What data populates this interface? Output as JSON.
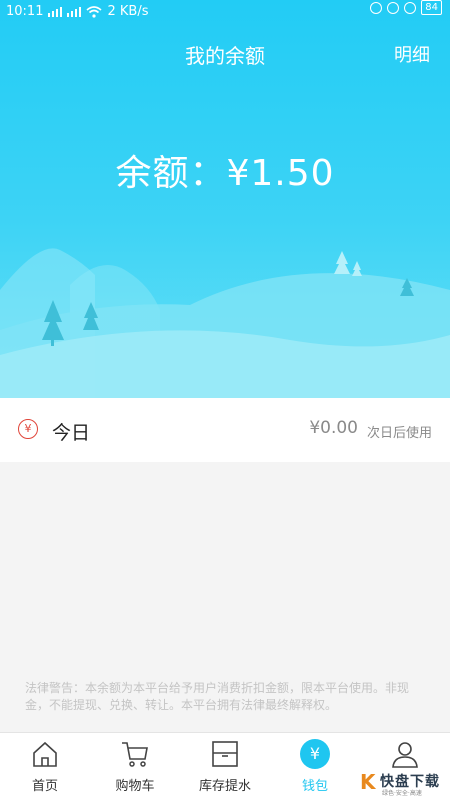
{
  "status_bar": {
    "time": "10:11",
    "speed": "2 KB/s",
    "battery": "84"
  },
  "header": {
    "title": "我的余额",
    "detail_label": "明细"
  },
  "balance_text": "余额：¥1.50",
  "today": {
    "icon_glyph": "¥",
    "label": "今日",
    "amount": "¥0.00",
    "note": "次日后使用"
  },
  "legal_notice": "法律警告：本余额为本平台给予用户消费折扣金额，限本平台使用。非现金，不能提现、兑换、转让。本平台拥有法律最终解释权。",
  "tabs": [
    {
      "label": "首页",
      "icon": "home-icon"
    },
    {
      "label": "购物车",
      "icon": "cart-icon"
    },
    {
      "label": "库存提水",
      "icon": "inventory-box-icon"
    },
    {
      "label": "钱包",
      "icon": "wallet-icon",
      "glyph": "¥",
      "active": true
    },
    {
      "label": "我的",
      "icon": "user-icon"
    }
  ],
  "watermark": {
    "glyph": "K",
    "text": "快盘下载",
    "subtext": "绿色·安全·高速"
  },
  "colors": {
    "accent": "#1fc6f0",
    "hero_top": "#22ccf5",
    "hero_bottom": "#66e0f6",
    "yuan_icon": "#e0453a"
  }
}
